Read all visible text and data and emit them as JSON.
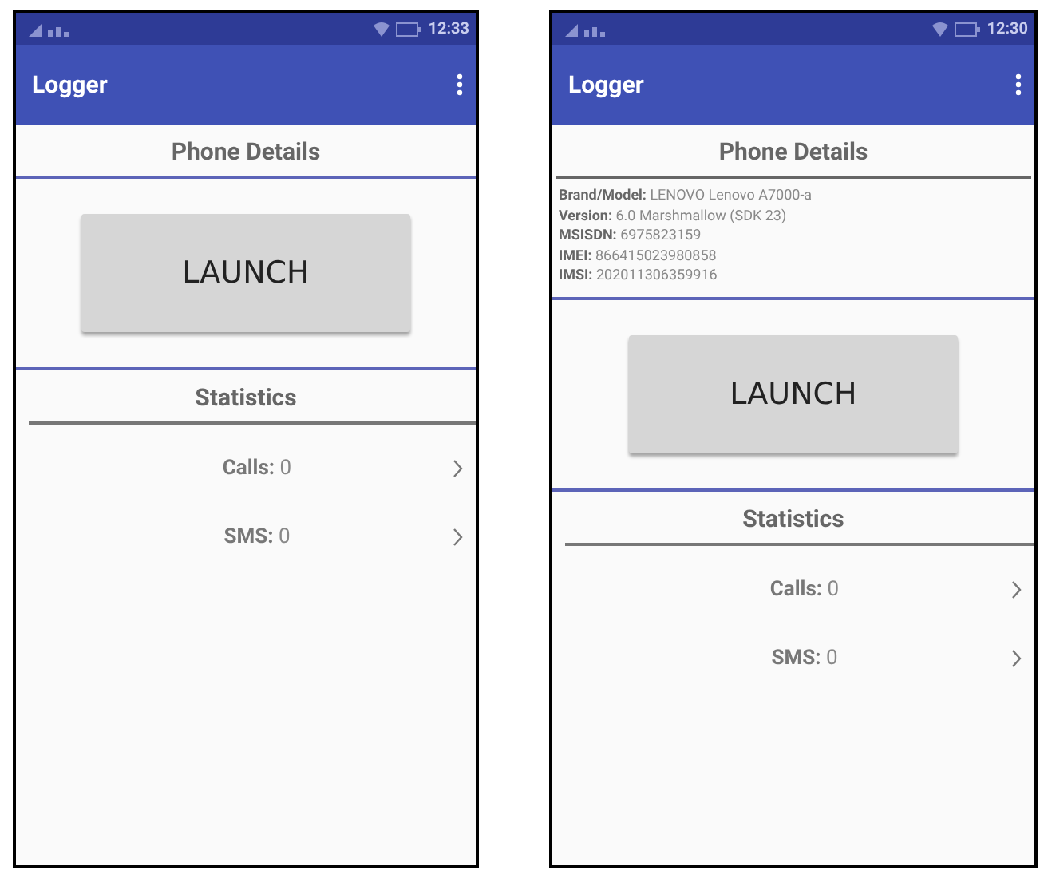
{
  "phones": [
    {
      "status_bar": {
        "time": "12:33"
      },
      "app_bar": {
        "title": "Logger"
      },
      "phone_details": {
        "title": "Phone Details"
      },
      "launch_button": "LAUNCH",
      "statistics": {
        "title": "Statistics",
        "items": [
          {
            "label": "Calls:",
            "value": "0"
          },
          {
            "label": "SMS:",
            "value": "0"
          }
        ]
      }
    },
    {
      "status_bar": {
        "time": "12:30"
      },
      "app_bar": {
        "title": "Logger"
      },
      "phone_details": {
        "title": "Phone Details",
        "lines": [
          "**Brand/Model:** LENOVO Lenovo A7000-a",
          "**Version:** 6.0 Marshmallow (SDK 23)",
          "**MSISDN:** 6975823159",
          "**IMEI:** 866415023980858",
          "**IMSI:** 202011306359916"
        ]
      },
      "launch_button": "LAUNCH",
      "statistics": {
        "title": "Statistics",
        "items": [
          {
            "label": "Calls:",
            "value": "0"
          },
          {
            "label": "SMS:",
            "value": "0"
          }
        ]
      }
    }
  ]
}
